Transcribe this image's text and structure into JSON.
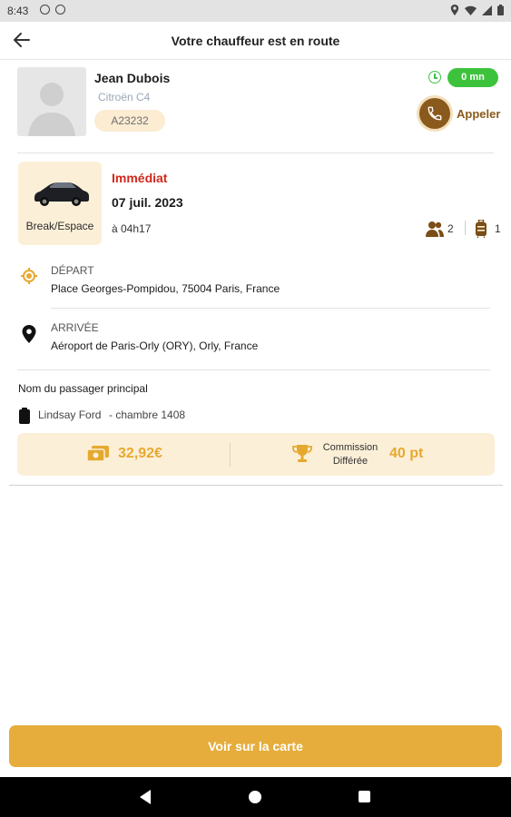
{
  "status_bar": {
    "time": "8:43",
    "icons": [
      "gear-icon",
      "record-icon",
      "location-icon",
      "wifi-icon",
      "signal-icon",
      "battery-icon"
    ]
  },
  "app_bar": {
    "title": "Votre chauffeur est en route",
    "back_icon": "arrow-left-icon"
  },
  "driver": {
    "name": "Jean Dubois",
    "car": "Citroën C4",
    "plate": "A23232",
    "eta": "0 mn",
    "call_label": "Appeler",
    "colors": {
      "eta_pill": "#3dc33b",
      "call_brown": "#8a5a1c"
    }
  },
  "ride": {
    "vehicle_label": "Break/Espace",
    "type": "Immédiat",
    "date": "07 juil. 2023",
    "time": "à 04h17",
    "passengers": "2",
    "luggage": "1",
    "colors": {
      "type": "#d0281c"
    }
  },
  "stops": {
    "departure": {
      "label": "DÉPART",
      "address": "Place Georges-Pompidou, 75004 Paris, France"
    },
    "arrival": {
      "label": "ARRIVÉE",
      "address": "Aéroport de Paris-Orly (ORY), Orly, France"
    }
  },
  "passenger": {
    "title": "Nom du passager principal",
    "name": "Lindsay Ford",
    "room": "- chambre 1408"
  },
  "pricing": {
    "price": "32,92€",
    "commission_line1": "Commission",
    "commission_line2": "Différée",
    "points": "40 pt",
    "colors": {
      "accent": "#e5a930",
      "background": "#fcefd8"
    }
  },
  "map_button": {
    "label": "Voir sur la carte",
    "color": "#e6ad3c"
  }
}
